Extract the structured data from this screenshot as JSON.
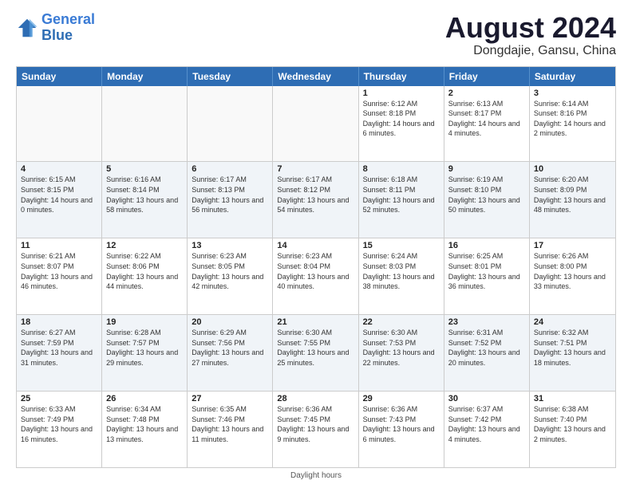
{
  "header": {
    "logo_line1": "General",
    "logo_line2": "Blue",
    "month_year": "August 2024",
    "location": "Dongdajie, Gansu, China"
  },
  "days_of_week": [
    "Sunday",
    "Monday",
    "Tuesday",
    "Wednesday",
    "Thursday",
    "Friday",
    "Saturday"
  ],
  "rows": [
    [
      {
        "day": "",
        "text": ""
      },
      {
        "day": "",
        "text": ""
      },
      {
        "day": "",
        "text": ""
      },
      {
        "day": "",
        "text": ""
      },
      {
        "day": "1",
        "text": "Sunrise: 6:12 AM\nSunset: 8:18 PM\nDaylight: 14 hours and 6 minutes."
      },
      {
        "day": "2",
        "text": "Sunrise: 6:13 AM\nSunset: 8:17 PM\nDaylight: 14 hours and 4 minutes."
      },
      {
        "day": "3",
        "text": "Sunrise: 6:14 AM\nSunset: 8:16 PM\nDaylight: 14 hours and 2 minutes."
      }
    ],
    [
      {
        "day": "4",
        "text": "Sunrise: 6:15 AM\nSunset: 8:15 PM\nDaylight: 14 hours and 0 minutes."
      },
      {
        "day": "5",
        "text": "Sunrise: 6:16 AM\nSunset: 8:14 PM\nDaylight: 13 hours and 58 minutes."
      },
      {
        "day": "6",
        "text": "Sunrise: 6:17 AM\nSunset: 8:13 PM\nDaylight: 13 hours and 56 minutes."
      },
      {
        "day": "7",
        "text": "Sunrise: 6:17 AM\nSunset: 8:12 PM\nDaylight: 13 hours and 54 minutes."
      },
      {
        "day": "8",
        "text": "Sunrise: 6:18 AM\nSunset: 8:11 PM\nDaylight: 13 hours and 52 minutes."
      },
      {
        "day": "9",
        "text": "Sunrise: 6:19 AM\nSunset: 8:10 PM\nDaylight: 13 hours and 50 minutes."
      },
      {
        "day": "10",
        "text": "Sunrise: 6:20 AM\nSunset: 8:09 PM\nDaylight: 13 hours and 48 minutes."
      }
    ],
    [
      {
        "day": "11",
        "text": "Sunrise: 6:21 AM\nSunset: 8:07 PM\nDaylight: 13 hours and 46 minutes."
      },
      {
        "day": "12",
        "text": "Sunrise: 6:22 AM\nSunset: 8:06 PM\nDaylight: 13 hours and 44 minutes."
      },
      {
        "day": "13",
        "text": "Sunrise: 6:23 AM\nSunset: 8:05 PM\nDaylight: 13 hours and 42 minutes."
      },
      {
        "day": "14",
        "text": "Sunrise: 6:23 AM\nSunset: 8:04 PM\nDaylight: 13 hours and 40 minutes."
      },
      {
        "day": "15",
        "text": "Sunrise: 6:24 AM\nSunset: 8:03 PM\nDaylight: 13 hours and 38 minutes."
      },
      {
        "day": "16",
        "text": "Sunrise: 6:25 AM\nSunset: 8:01 PM\nDaylight: 13 hours and 36 minutes."
      },
      {
        "day": "17",
        "text": "Sunrise: 6:26 AM\nSunset: 8:00 PM\nDaylight: 13 hours and 33 minutes."
      }
    ],
    [
      {
        "day": "18",
        "text": "Sunrise: 6:27 AM\nSunset: 7:59 PM\nDaylight: 13 hours and 31 minutes."
      },
      {
        "day": "19",
        "text": "Sunrise: 6:28 AM\nSunset: 7:57 PM\nDaylight: 13 hours and 29 minutes."
      },
      {
        "day": "20",
        "text": "Sunrise: 6:29 AM\nSunset: 7:56 PM\nDaylight: 13 hours and 27 minutes."
      },
      {
        "day": "21",
        "text": "Sunrise: 6:30 AM\nSunset: 7:55 PM\nDaylight: 13 hours and 25 minutes."
      },
      {
        "day": "22",
        "text": "Sunrise: 6:30 AM\nSunset: 7:53 PM\nDaylight: 13 hours and 22 minutes."
      },
      {
        "day": "23",
        "text": "Sunrise: 6:31 AM\nSunset: 7:52 PM\nDaylight: 13 hours and 20 minutes."
      },
      {
        "day": "24",
        "text": "Sunrise: 6:32 AM\nSunset: 7:51 PM\nDaylight: 13 hours and 18 minutes."
      }
    ],
    [
      {
        "day": "25",
        "text": "Sunrise: 6:33 AM\nSunset: 7:49 PM\nDaylight: 13 hours and 16 minutes."
      },
      {
        "day": "26",
        "text": "Sunrise: 6:34 AM\nSunset: 7:48 PM\nDaylight: 13 hours and 13 minutes."
      },
      {
        "day": "27",
        "text": "Sunrise: 6:35 AM\nSunset: 7:46 PM\nDaylight: 13 hours and 11 minutes."
      },
      {
        "day": "28",
        "text": "Sunrise: 6:36 AM\nSunset: 7:45 PM\nDaylight: 13 hours and 9 minutes."
      },
      {
        "day": "29",
        "text": "Sunrise: 6:36 AM\nSunset: 7:43 PM\nDaylight: 13 hours and 6 minutes."
      },
      {
        "day": "30",
        "text": "Sunrise: 6:37 AM\nSunset: 7:42 PM\nDaylight: 13 hours and 4 minutes."
      },
      {
        "day": "31",
        "text": "Sunrise: 6:38 AM\nSunset: 7:40 PM\nDaylight: 13 hours and 2 minutes."
      }
    ]
  ],
  "footer": {
    "note": "Daylight hours"
  }
}
